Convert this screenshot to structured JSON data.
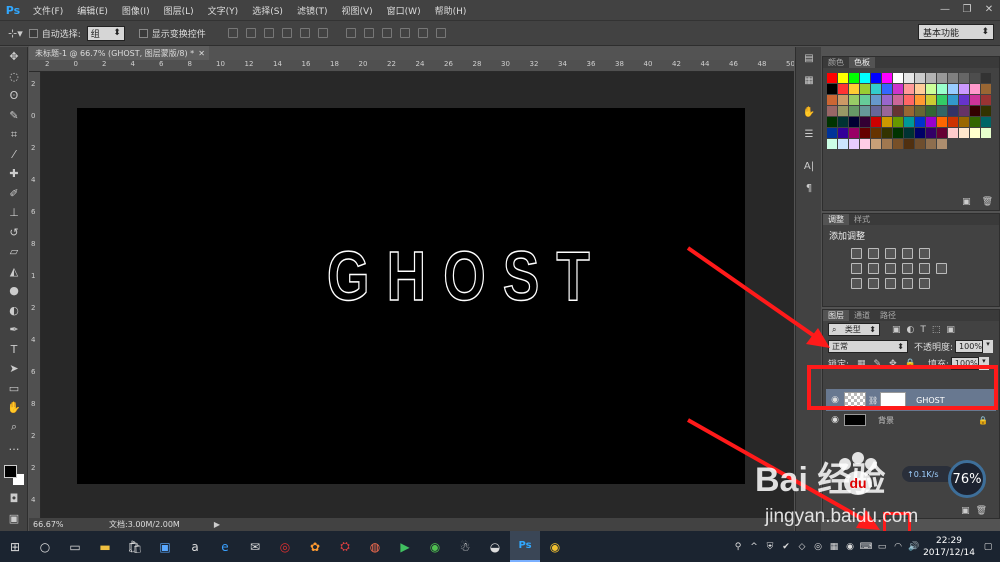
{
  "app": {
    "logo": "Ps"
  },
  "menu": [
    "文件(F)",
    "编辑(E)",
    "图像(I)",
    "图层(L)",
    "文字(Y)",
    "选择(S)",
    "滤镜(T)",
    "视图(V)",
    "窗口(W)",
    "帮助(H)"
  ],
  "options": {
    "auto_select_label": "自动选择:",
    "auto_select_value": "组",
    "show_transform_label": "显示变换控件",
    "workspace": "基本功能"
  },
  "document": {
    "tab_title": "未标题-1 @ 66.7% (GHOST, 图层蒙版/8) *",
    "text": "GHOST",
    "zoom": "66.67%",
    "doc_size": "文档:3.00M/2.00M"
  },
  "ruler": {
    "h_ticks": [
      "2",
      "0",
      "2",
      "4",
      "6",
      "8",
      "10",
      "12",
      "14",
      "16",
      "18",
      "20",
      "22",
      "24",
      "26",
      "28",
      "30",
      "32",
      "34",
      "36",
      "38",
      "40",
      "42",
      "44",
      "46",
      "48",
      "50"
    ],
    "v_ticks": [
      "2",
      "0",
      "2",
      "4",
      "6",
      "8",
      "1",
      "2",
      "4",
      "6",
      "8",
      "2",
      "2",
      "4"
    ]
  },
  "colors": {
    "accent_red": "#ff1a1a",
    "selected_layer": "#687890",
    "swatches": [
      "#ff0000",
      "#ffff00",
      "#00ff00",
      "#00ffff",
      "#0000ff",
      "#ff00ff",
      "#ffffff",
      "#e6e6e6",
      "#cccccc",
      "#b3b3b3",
      "#999999",
      "#808080",
      "#666666",
      "#4d4d4d",
      "#333333",
      "#000000",
      "#ff3333",
      "#ffcc33",
      "#99cc33",
      "#33cccc",
      "#3366ff",
      "#cc33cc",
      "#ff9999",
      "#ffcc99",
      "#ccff99",
      "#99ffcc",
      "#99ccff",
      "#cc99ff",
      "#ff99cc",
      "#996633",
      "#cc6633",
      "#cc9966",
      "#99cc66",
      "#66cc99",
      "#6699cc",
      "#9966cc",
      "#cc6699",
      "#ff6666",
      "#ff9933",
      "#cccc33",
      "#33cc66",
      "#3399cc",
      "#6633cc",
      "#cc3399",
      "#993333",
      "#996666",
      "#999966",
      "#669966",
      "#669999",
      "#666699",
      "#996699",
      "#663333",
      "#996633",
      "#666633",
      "#336633",
      "#336666",
      "#333366",
      "#663366",
      "#330000",
      "#333300",
      "#003300",
      "#003333",
      "#000033",
      "#330033",
      "#cc0000",
      "#cc9900",
      "#669900",
      "#009999",
      "#0033cc",
      "#9900cc",
      "#ff6600",
      "#cc3300",
      "#996600",
      "#336600",
      "#006666",
      "#003399",
      "#330099",
      "#990066",
      "#660000",
      "#663300",
      "#333300",
      "#003300",
      "#003333",
      "#000066",
      "#330066",
      "#660033",
      "#ffcccc",
      "#ffe6cc",
      "#ffffcc",
      "#e6ffcc",
      "#ccffe6",
      "#cce6ff",
      "#e6ccff",
      "#ffcce6",
      "#c8a078",
      "#a07850",
      "#785028",
      "#503010",
      "#6e4e2e",
      "#8e6e4e",
      "#ae8e6e"
    ]
  },
  "panels": {
    "color_tabs": [
      "颜色",
      "色板"
    ],
    "adjust_tabs": [
      "调整",
      "样式"
    ],
    "adjust_title": "添加调整",
    "layers_tabs": [
      "图层",
      "通道",
      "路径"
    ],
    "filter_kind": "类型",
    "blend_mode": "正常",
    "opacity_label": "不透明度:",
    "opacity_value": "100%",
    "lock_label": "锁定:",
    "fill_label": "填充:",
    "fill_value": "100%",
    "layers": [
      {
        "name": "GHOST"
      },
      {
        "name": "背景"
      }
    ]
  },
  "watermark": {
    "logo": "Bai  经验",
    "url": "jingyan.baidu.com"
  },
  "net_widget": {
    "speed": "0.1K/s",
    "percent": "76%"
  },
  "taskbar": {
    "time": "22:29",
    "date": "2017/12/14"
  }
}
